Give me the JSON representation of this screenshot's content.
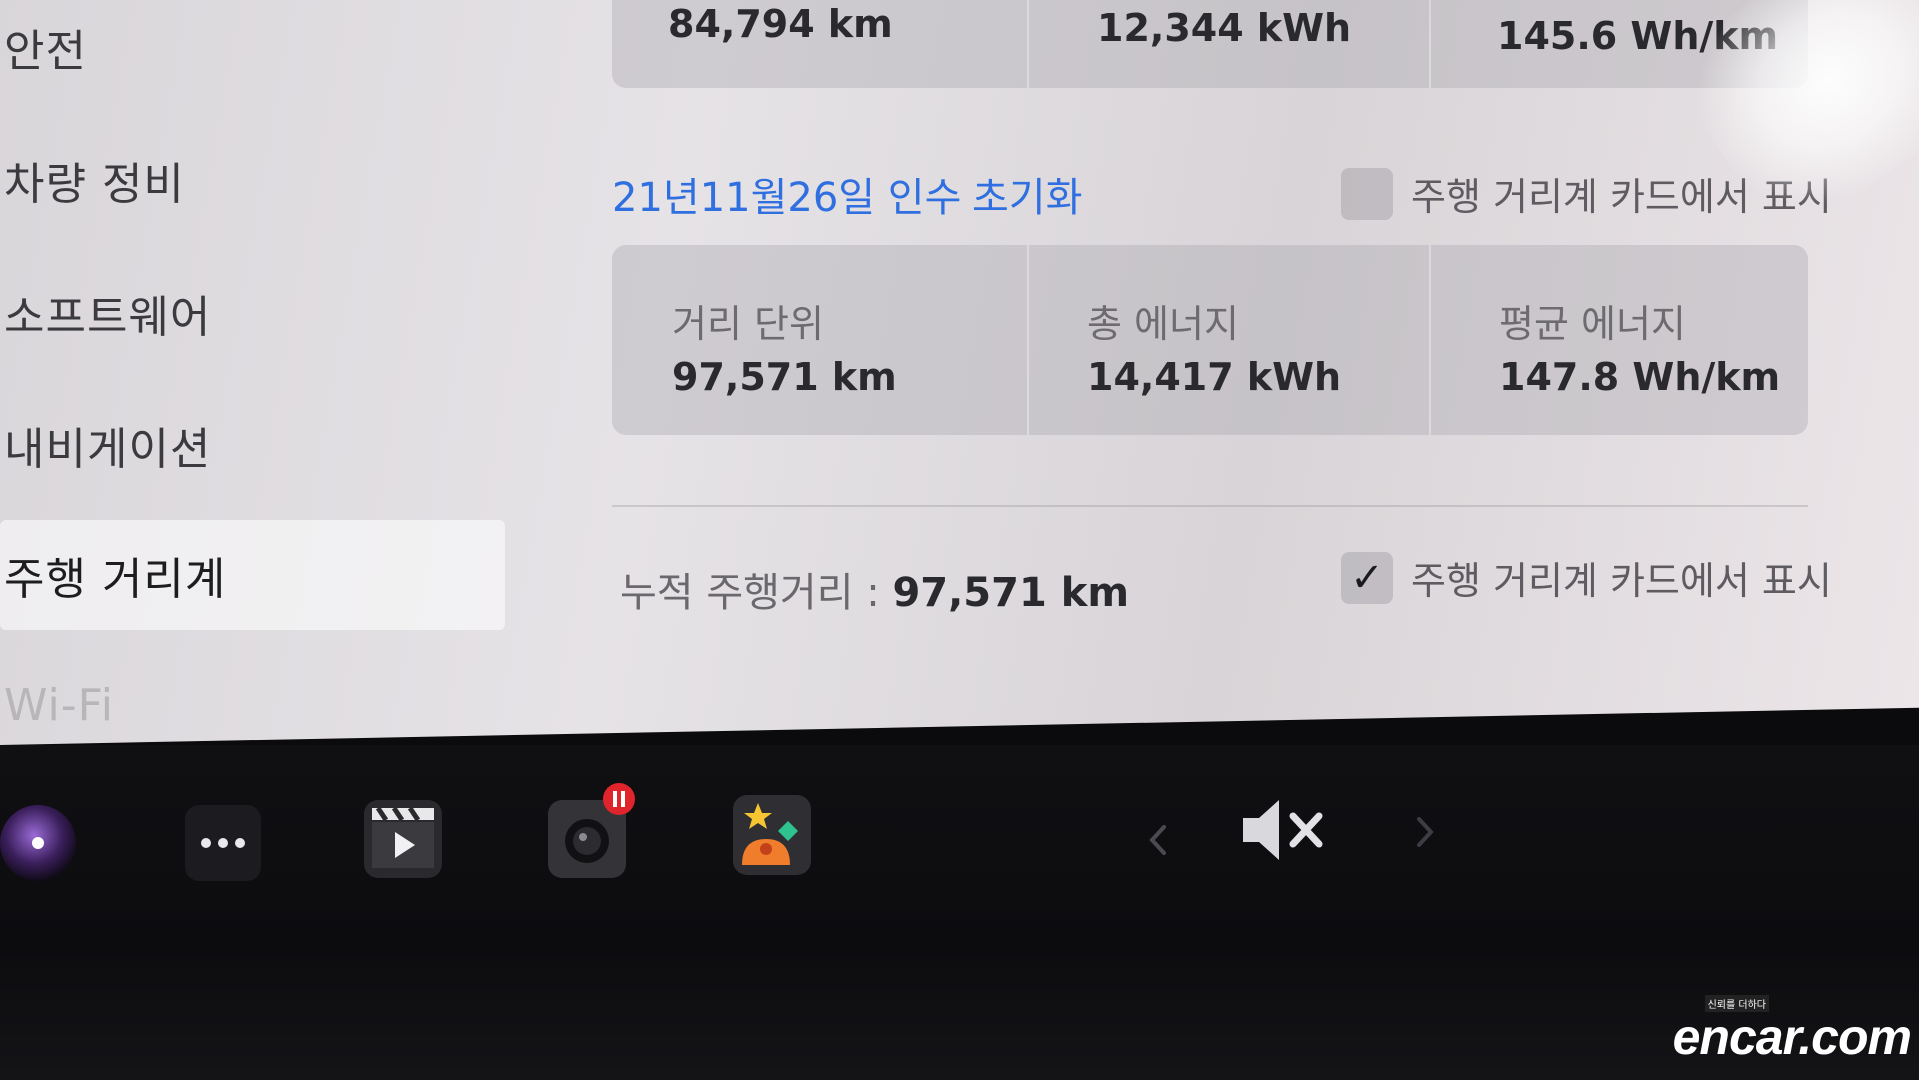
{
  "sidebar": {
    "items": [
      {
        "label": "안전"
      },
      {
        "label": "차량 정비"
      },
      {
        "label": "소프트웨어"
      },
      {
        "label": "내비게이션"
      },
      {
        "label": "주행 거리계"
      },
      {
        "label": "Wi-Fi"
      }
    ],
    "active_index": 4
  },
  "trip_top": {
    "distance": "84,794 km",
    "energy": "12,344 kWh",
    "avg": "145.6 Wh/km"
  },
  "trip_since": {
    "date_label": "21년11월26일 인수",
    "reset_label": "초기화",
    "show_on_card_label": "주행 거리계 카드에서 표시",
    "show_on_card_checked": false,
    "col_distance_label": "거리 단위",
    "col_energy_label": "총 에너지",
    "col_avg_label": "평균 에너지",
    "distance": "97,571 km",
    "energy": "14,417 kWh",
    "avg": "147.8 Wh/km"
  },
  "odometer": {
    "label": "누적 주행거리 :",
    "value": "97,571 km",
    "show_on_card_label": "주행 거리계 카드에서 표시",
    "show_on_card_checked": true,
    "check_glyph": "✓"
  },
  "taskbar": {
    "icons": [
      "camera-icon",
      "more-icon",
      "theater-icon",
      "dashcam-icon",
      "toybox-icon"
    ],
    "volume_icon": "volume-muted-icon",
    "dashcam_badge_color": "#e0242c"
  },
  "colors": {
    "link": "#2f6fe0",
    "panel": "#e3e0e4",
    "taskbar": "#0e0e11"
  },
  "watermark": {
    "text": "encar.com",
    "tag": "신뢰를 더하다"
  }
}
